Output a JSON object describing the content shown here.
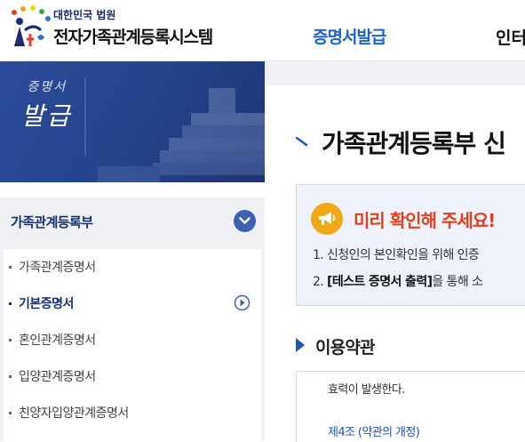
{
  "header": {
    "org_name": "대한민국 법원",
    "system_name": "전자가족관계등록시스템",
    "nav_active": "증명서발급",
    "nav_next": "인터"
  },
  "banner": {
    "line1": "증명서",
    "line2": "발급"
  },
  "sidebar": {
    "title": "가족관계등록부",
    "items": [
      {
        "label": "가족관계증명서",
        "active": false
      },
      {
        "label": "기본증명서",
        "active": true
      },
      {
        "label": "혼인관계증명서",
        "active": false
      },
      {
        "label": "입양관계증명서",
        "active": false
      },
      {
        "label": "친양자입양관계증명서",
        "active": false
      }
    ]
  },
  "main": {
    "page_title": "가족관계등록부 신",
    "notice": {
      "title": "미리 확인해 주세요!",
      "line1": "1. 신청인의 본인확인을 위해 인증",
      "line2_num": "2. ",
      "line2_bold": "[테스트 증명서 출력]",
      "line2_rest": "을 통해 소"
    },
    "terms": {
      "title": "이용약관",
      "text": "효력이 발생한다.",
      "link": "제4조 (약관의 개정)"
    }
  },
  "colors": {
    "brand_blue": "#1e63c8",
    "navy": "#16316f",
    "notice_red": "#e0401e",
    "notice_icon": "#f0a818"
  }
}
